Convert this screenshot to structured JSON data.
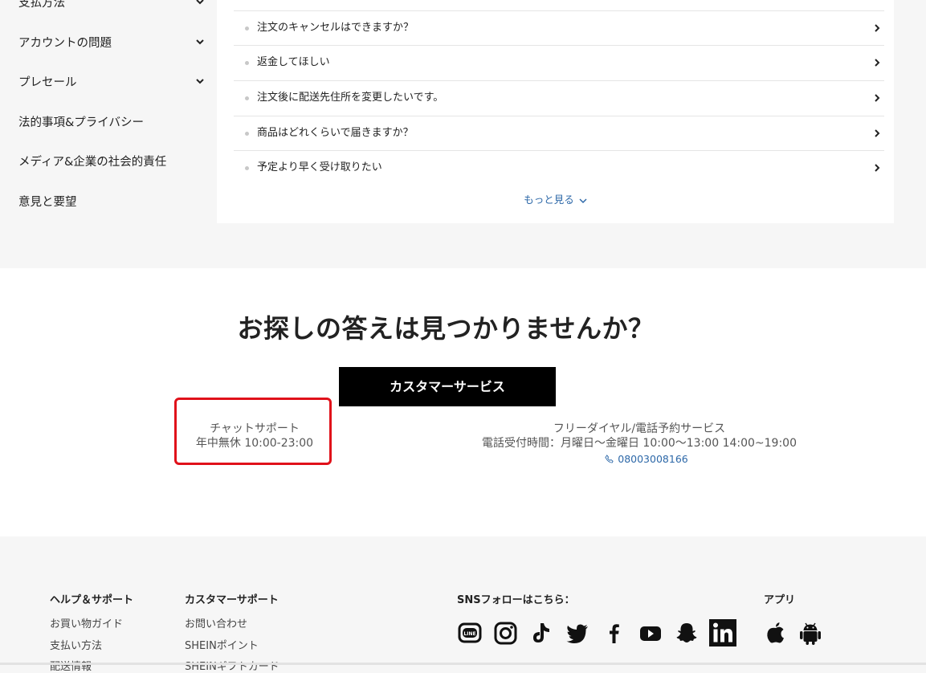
{
  "sidebar": {
    "items": [
      {
        "label": "支払方法",
        "expandable": true
      },
      {
        "label": "アカウントの問題",
        "expandable": true
      },
      {
        "label": "プレセール",
        "expandable": true
      },
      {
        "label": "法的事項&プライバシー",
        "expandable": false
      },
      {
        "label": "メディア&企業の社会的責任",
        "expandable": false
      },
      {
        "label": "意見と要望",
        "expandable": false
      }
    ]
  },
  "faq": {
    "questions": [
      "注文のキャンセルはできますか？",
      "返金してほしい",
      "注文後に配送先住所を変更したいです。",
      "商品はどれくらいで届きますか？",
      "予定より早く受け取りたい"
    ],
    "more_label": "もっと見る"
  },
  "contact": {
    "headline": "お探しの答えは見つかりませんか？",
    "button_label": "カスタマーサービス",
    "chat_title": "チャットサポート",
    "chat_hours": "年中無休 10:00-23:00",
    "tel_title": "フリーダイヤル/電話予約サービス",
    "tel_hours": "電話受付時間：月曜日～金曜日 10:00～13:00 14:00~19:00",
    "tel_number": "08003008166",
    "highlight_color": "#e0111a",
    "link_color": "#2d68a8"
  },
  "footer": {
    "help": {
      "heading": "ヘルプ＆サポート",
      "links": [
        "お買い物ガイド",
        "支払い方法",
        "配送情報"
      ]
    },
    "customer": {
      "heading": "カスタマーサポート",
      "links": [
        "お問い合わせ",
        "SHEINポイント",
        "SHEINギフトカード"
      ]
    },
    "sns": {
      "heading": "SNSフォローはこちら：",
      "icons": [
        "line-icon",
        "instagram-icon",
        "tiktok-icon",
        "twitter-icon",
        "facebook-icon",
        "youtube-icon",
        "snapchat-icon",
        "linkedin-icon"
      ]
    },
    "app": {
      "heading": "アプリ",
      "icons": [
        "apple-icon",
        "android-icon"
      ]
    }
  }
}
